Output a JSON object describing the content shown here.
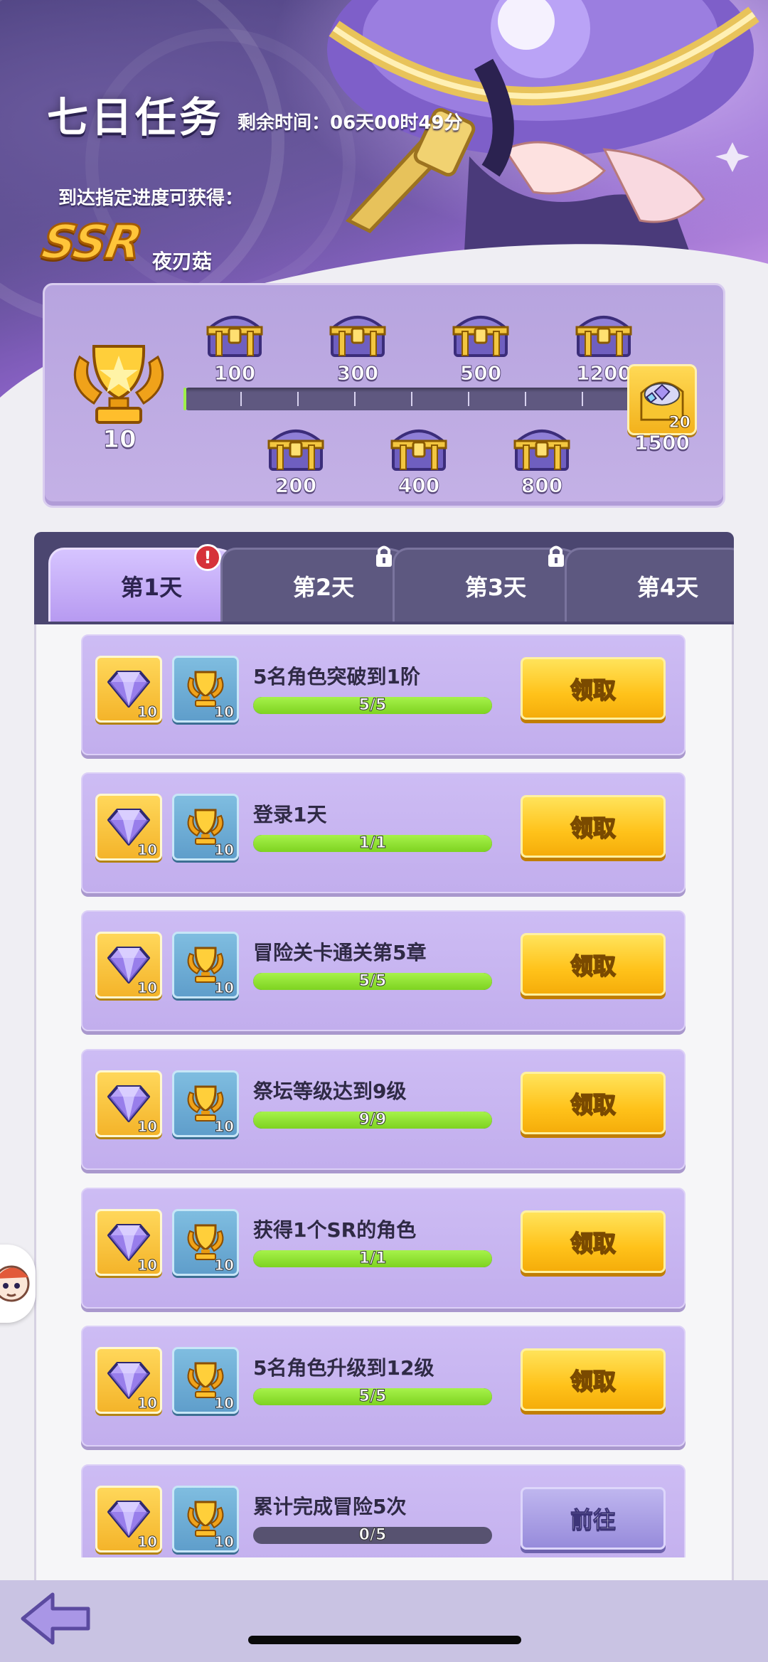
{
  "header": {
    "title": "七日任务",
    "timer": "剩余时间：06天00时49分",
    "reach_text": "到达指定进度可获得：",
    "ssr_badge": "SSR",
    "ssr_name": "夜刃菇"
  },
  "progress": {
    "current_points": "10",
    "top_chests": [
      "100",
      "300",
      "500",
      "1200"
    ],
    "bottom_chests": [
      "200",
      "400",
      "800"
    ],
    "final_milestone": "1500",
    "final_reward_count": "20",
    "fraction": 0.0067
  },
  "tabs": [
    {
      "label": "第1天",
      "active": true,
      "alert": "!"
    },
    {
      "label": "第2天",
      "locked": true
    },
    {
      "label": "第3天",
      "locked": true
    },
    {
      "label": "第4天",
      "locked": true
    }
  ],
  "tasks": [
    {
      "title": "5名角色突破到1阶",
      "progress_text": "5/5",
      "progress": 1.0,
      "gem_count": "10",
      "trophy_count": "10",
      "button": "领取"
    },
    {
      "title": "登录1天",
      "progress_text": "1/1",
      "progress": 1.0,
      "gem_count": "10",
      "trophy_count": "10",
      "button": "领取"
    },
    {
      "title": "冒险关卡通关第5章",
      "progress_text": "5/5",
      "progress": 1.0,
      "gem_count": "10",
      "trophy_count": "10",
      "button": "领取"
    },
    {
      "title": "祭坛等级达到9级",
      "progress_text": "9/9",
      "progress": 1.0,
      "gem_count": "10",
      "trophy_count": "10",
      "button": "领取"
    },
    {
      "title": "获得1个SR的角色",
      "progress_text": "1/1",
      "progress": 1.0,
      "gem_count": "10",
      "trophy_count": "10",
      "button": "领取"
    },
    {
      "title": "5名角色升级到12级",
      "progress_text": "5/5",
      "progress": 1.0,
      "gem_count": "10",
      "trophy_count": "10",
      "button": "领取"
    },
    {
      "title": "累计完成冒险5次",
      "progress_text": "0/5",
      "progress": 0.0,
      "gem_count": "10",
      "trophy_count": "10",
      "button": "前往"
    }
  ],
  "icons": {
    "gem": "purple-gem-icon",
    "trophy": "gold-trophy-icon",
    "chest": "treasure-chest-icon",
    "lock": "lock-icon",
    "back": "back-arrow-icon"
  },
  "colors": {
    "claim": "#ffc21a",
    "goto": "#978bdb",
    "progress_fill": "#7ed321",
    "alert": "#d6323a"
  }
}
